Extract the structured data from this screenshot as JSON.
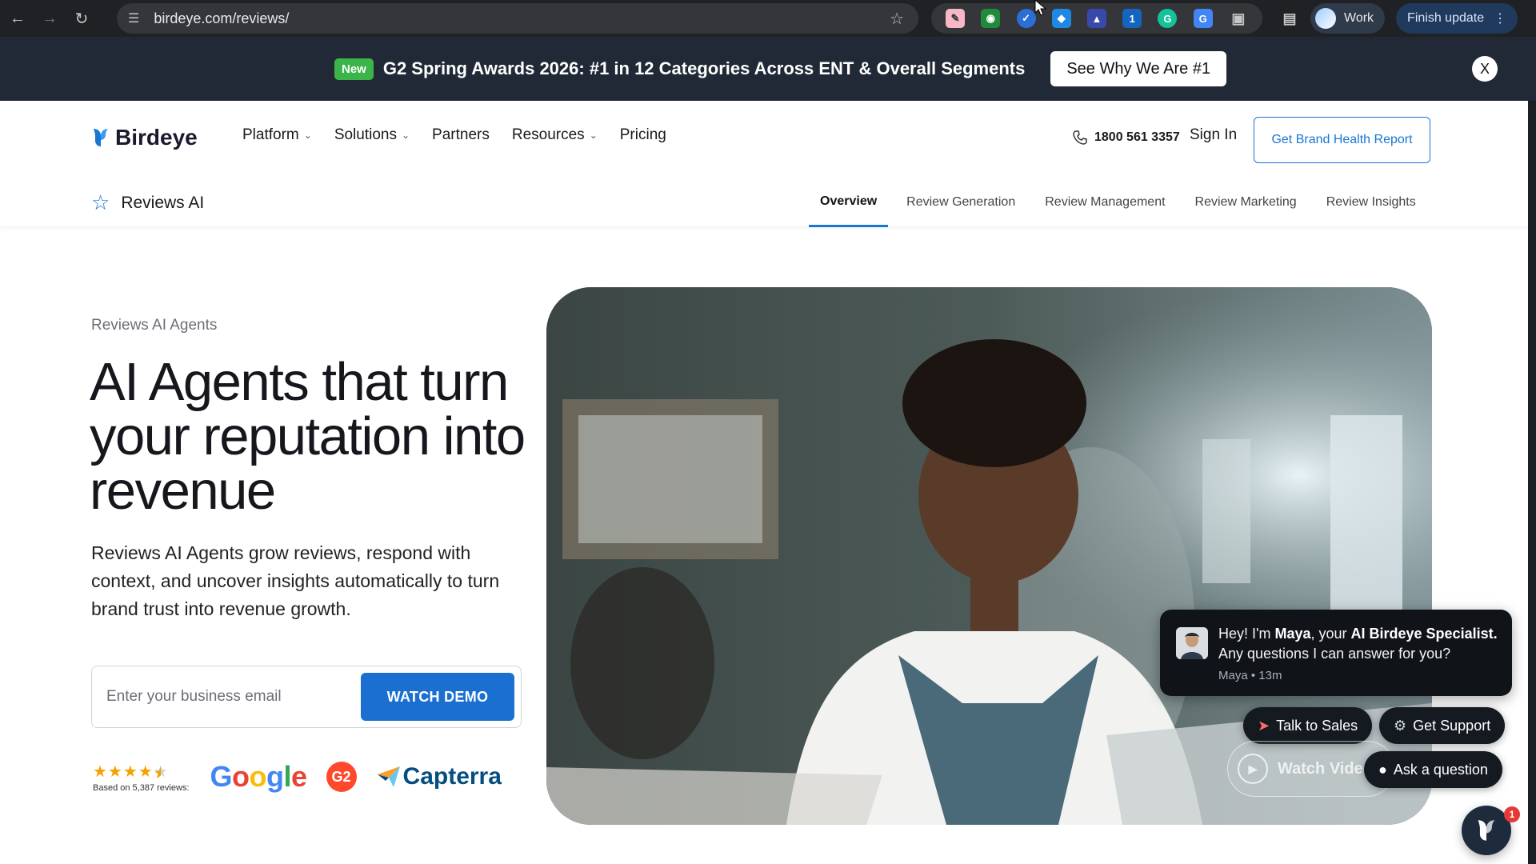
{
  "browser": {
    "url": "birdeye.com/reviews/",
    "profile_label": "Work",
    "update_label": "Finish update"
  },
  "announcement": {
    "badge": "New",
    "text": "G2 Spring Awards 2026: #1 in 12 Categories Across ENT & Overall Segments",
    "cta": "See Why We Are #1",
    "close": "X"
  },
  "nav": {
    "brand": "Birdeye",
    "items": [
      {
        "label": "Platform",
        "dropdown": true
      },
      {
        "label": "Solutions",
        "dropdown": true
      },
      {
        "label": "Partners",
        "dropdown": false
      },
      {
        "label": "Resources",
        "dropdown": true
      },
      {
        "label": "Pricing",
        "dropdown": false
      }
    ],
    "phone": "1800 561 3357",
    "signin": "Sign In",
    "cta": "Get Brand Health Report"
  },
  "subnav": {
    "title": "Reviews AI",
    "tabs": [
      {
        "label": "Overview",
        "active": true
      },
      {
        "label": "Review Generation",
        "active": false
      },
      {
        "label": "Review Management",
        "active": false
      },
      {
        "label": "Review Marketing",
        "active": false
      },
      {
        "label": "Review Insights",
        "active": false
      }
    ]
  },
  "hero": {
    "eyebrow": "Reviews AI Agents",
    "headline": "AI Agents that turn your reputation into revenue",
    "description": "Reviews AI Agents grow reviews, respond with context, and uncover insights automatically to turn brand trust into revenue growth.",
    "email_placeholder": "Enter your business email",
    "email_value": "",
    "cta": "WATCH DEMO",
    "rating_stars": 4.5,
    "rating_caption": "Based on 5,387 reviews:",
    "logos": [
      "Google",
      "G2",
      "Capterra"
    ]
  },
  "chat": {
    "greeting_prefix": "Hey! I'm ",
    "agent_name": "Maya",
    "greeting_mid": ", your ",
    "agent_role": "AI Birdeye Specialist.",
    "greeting_suffix": " Any questions I can answer for you?",
    "meta": "Maya • 13m",
    "talk_to_sales": "Talk to Sales",
    "get_support": "Get Support",
    "watch_video": "Watch Video",
    "ask_question": "Ask a question",
    "badge_count": "1"
  },
  "colors": {
    "accent": "#1976d2",
    "announce_bg": "#212936",
    "new_badge": "#3bb54a",
    "cta_blue": "#1a6fd1"
  }
}
